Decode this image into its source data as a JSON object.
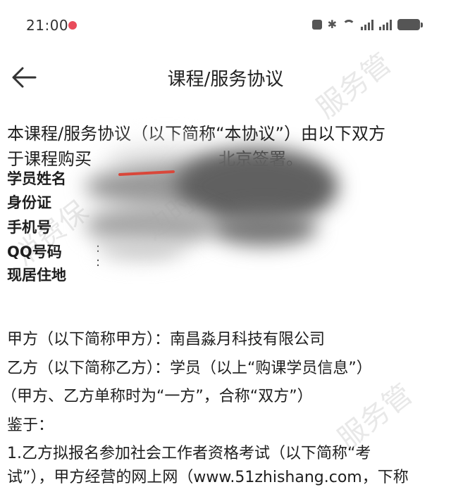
{
  "status_bar": {
    "time": "21:00"
  },
  "nav": {
    "title": "课程/服务协议"
  },
  "agreement": {
    "intro_line1": "本课程/服务协议（以下简称“本协议”）由以下双方",
    "intro_line2_a": "于课程购买",
    "intro_line2_b": "北京签署。",
    "fields": [
      "学员姓名",
      "身份证",
      "手机号",
      "QQ号码",
      "现居住地"
    ],
    "party_a": "甲方（以下简称甲方）：南昌淼月科技有限公司",
    "party_b": "乙方（以下简称乙方）：学员（以上“购课学员信息”）",
    "parties_note": "（甲方、乙方单称时为“一方”，合称“双方”）",
    "whereas": "鉴于：",
    "clause1_line1": "1.乙方拟报名参加社会工作者资格考试（以下简称“考",
    "clause1_line2": "试”），甲方经营的网上网（www.51zhishang.com，下称"
  },
  "watermark": {
    "text": "消费保 边时消费服务管"
  }
}
